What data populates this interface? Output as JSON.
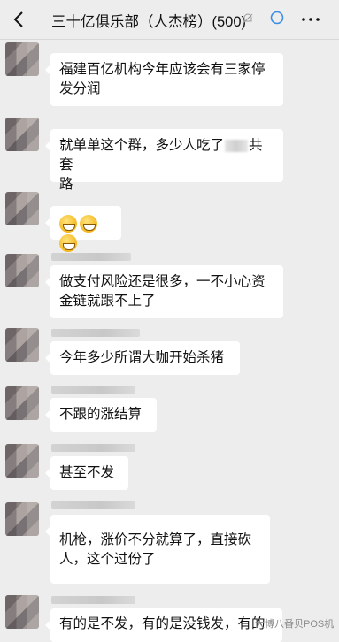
{
  "header": {
    "title": "三十亿俱乐部（人杰榜）(500)",
    "back_icon": "chevron-left-icon",
    "mute_icon": "bell-muted-icon",
    "status_icon": "circle-icon",
    "more_icon": "ellipsis-icon"
  },
  "messages": [
    {
      "line1": "福建百亿机构今年应该会有三家停",
      "line2": "发分润"
    },
    {
      "line1a": "就单单这个群，多少人吃了",
      "line1b": "共套",
      "line2": "路"
    },
    {
      "emojis": [
        "grin-emoji",
        "grin-emoji",
        "grin-emoji"
      ]
    },
    {
      "line1": "做支付风险还是很多，一不小心资",
      "line2": "金链就跟不上了"
    },
    {
      "line1": "今年多少所谓大咖开始杀猪"
    },
    {
      "line1": "不跟的涨结算"
    },
    {
      "line1": "甚至不发"
    },
    {
      "line1": "机枪，涨价不分就算了，直接砍",
      "line2": "人，这个过份了"
    },
    {
      "line1": "有的是不发，有的是没钱发，有的"
    }
  ],
  "watermark": "大博八番贝POS机"
}
